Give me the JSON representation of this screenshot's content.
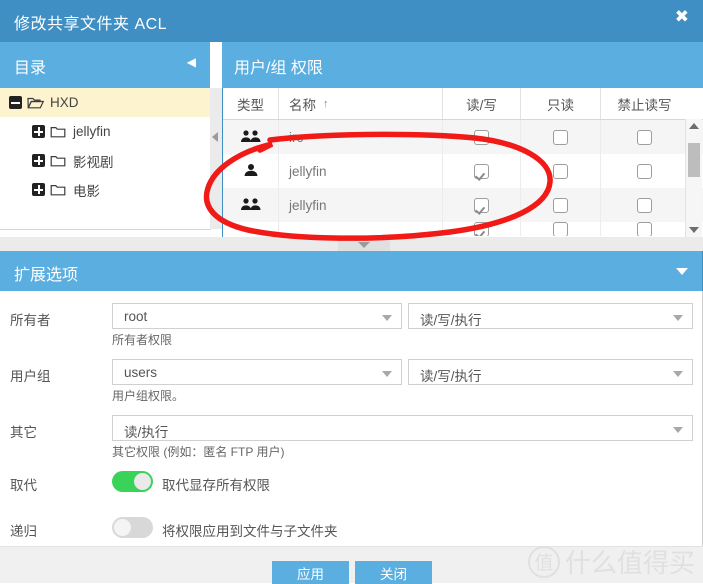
{
  "window": {
    "title": "修改共享文件夹 ACL",
    "close_icon": "✖"
  },
  "directory_panel": {
    "header": "目录",
    "collapse_icon": "◀",
    "tree": [
      {
        "label": "HXD",
        "expanded": true,
        "selected": true,
        "level": 0,
        "toggle": "minus"
      },
      {
        "label": "jellyfin",
        "expanded": false,
        "selected": false,
        "level": 1,
        "toggle": "plus"
      },
      {
        "label": "影视剧",
        "expanded": false,
        "selected": false,
        "level": 1,
        "toggle": "plus"
      },
      {
        "label": "电影",
        "expanded": false,
        "selected": false,
        "level": 1,
        "toggle": "plus"
      }
    ]
  },
  "acl_panel": {
    "header": "用户/组 权限",
    "columns": [
      "类型",
      "名称",
      "读/写",
      "只读",
      "禁止读写"
    ],
    "sort_column": "名称",
    "sort_indicator": "↑",
    "rows": [
      {
        "type_icon": "group-icon",
        "name": "irc",
        "read_write": false,
        "read_only": false,
        "deny": false
      },
      {
        "type_icon": "user-icon",
        "name": "jellyfin",
        "read_write": true,
        "read_only": false,
        "deny": false
      },
      {
        "type_icon": "group-icon",
        "name": "jellyfin",
        "read_write": true,
        "read_only": false,
        "deny": false
      }
    ],
    "scrollbar": {
      "up_icon": "▲",
      "down_icon": "▼"
    }
  },
  "extended_options": {
    "header": "扩展选项",
    "caret_icon": "▼",
    "owner": {
      "label": "所有者",
      "value": "root",
      "permission": "读/写/执行",
      "hint": "所有者权限"
    },
    "group": {
      "label": "用户组",
      "value": "users",
      "permission": "读/写/执行",
      "hint": "用户组权限。"
    },
    "others": {
      "label": "其它",
      "permission": "读/执行",
      "hint": "其它权限 (例如：匿名 FTP 用户)"
    },
    "replace": {
      "label": "取代",
      "text": "取代显存所有权限",
      "enabled": true
    },
    "recursive": {
      "label": "递归",
      "text": "将权限应用到文件与子文件夹",
      "enabled": false
    }
  },
  "footer": {
    "apply": "应用",
    "close": "关闭"
  },
  "watermark": {
    "badge": "值",
    "text": "什么值得买"
  },
  "colors": {
    "titlebar": "#3f8fc4",
    "section_header": "#5aaee0",
    "button": "#5aaee0",
    "selected_row": "#fdf3cf",
    "toggle_on": "#3ad35a",
    "annotation": "#f01a16"
  }
}
